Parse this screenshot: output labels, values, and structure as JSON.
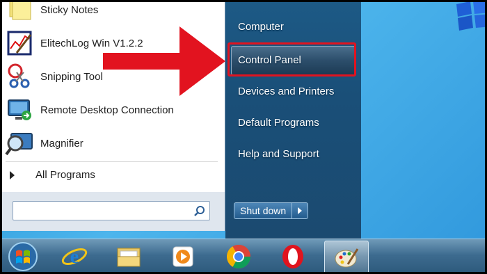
{
  "start_menu": {
    "programs": [
      {
        "label": "Sticky Notes",
        "icon": "sticky-notes-icon"
      },
      {
        "label": "ElitechLog Win V1.2.2",
        "icon": "elitechlog-icon"
      },
      {
        "label": "Snipping Tool",
        "icon": "snipping-tool-icon"
      },
      {
        "label": "Remote Desktop Connection",
        "icon": "remote-desktop-icon"
      },
      {
        "label": "Magnifier",
        "icon": "magnifier-icon"
      }
    ],
    "all_programs": "All Programs",
    "search": {
      "value": "",
      "placeholder": ""
    },
    "right_items": [
      {
        "label": "Computer"
      },
      {
        "label": "Control Panel"
      },
      {
        "label": "Devices and Printers"
      },
      {
        "label": "Default Programs"
      },
      {
        "label": "Help and Support"
      }
    ],
    "shutdown_label": "Shut down",
    "highlight_color": "#e2131f"
  },
  "taskbar": {
    "items": [
      {
        "name": "start-orb",
        "icon": "windows-logo-icon"
      },
      {
        "name": "internet-explorer",
        "icon": "internet-explorer-icon"
      },
      {
        "name": "file-explorer",
        "icon": "folder-icon"
      },
      {
        "name": "media-player",
        "icon": "media-player-icon"
      },
      {
        "name": "chrome",
        "icon": "chrome-icon"
      },
      {
        "name": "opera",
        "icon": "opera-icon"
      },
      {
        "name": "paint",
        "icon": "paint-icon"
      }
    ]
  }
}
